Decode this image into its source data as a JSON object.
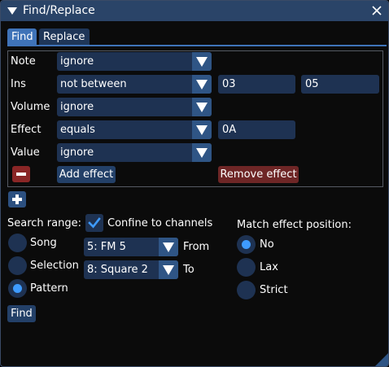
{
  "window": {
    "title": "Find/Replace"
  },
  "tabs": [
    {
      "label": "Find"
    },
    {
      "label": "Replace"
    }
  ],
  "query": {
    "rows": [
      {
        "label": "Note",
        "mode": "ignore"
      },
      {
        "label": "Ins",
        "mode": "not between",
        "value1": "03",
        "value2": "05"
      },
      {
        "label": "Volume",
        "mode": "ignore"
      },
      {
        "label": "Effect",
        "mode": "equals",
        "value1": "0A"
      },
      {
        "label": "Value",
        "mode": "ignore"
      }
    ],
    "add_effect": "Add effect",
    "remove_effect": "Remove effect"
  },
  "search_range": {
    "label": "Search range:",
    "options": [
      "Song",
      "Selection",
      "Pattern"
    ],
    "selected": "Pattern"
  },
  "channels": {
    "confine_label": "Confine to channels",
    "confine_checked": true,
    "from_value": "5: FM 5",
    "from_label": "From",
    "to_value": "8: Square 2",
    "to_label": "To"
  },
  "match_effect": {
    "label": "Match effect position:",
    "options": [
      "No",
      "Lax",
      "Strict"
    ],
    "selected": "No"
  },
  "find_button": "Find",
  "colors": {
    "accent": "#3e9bff",
    "frame": "#1e3252",
    "title_bar": "#2a4468",
    "danger": "#6e2626"
  }
}
